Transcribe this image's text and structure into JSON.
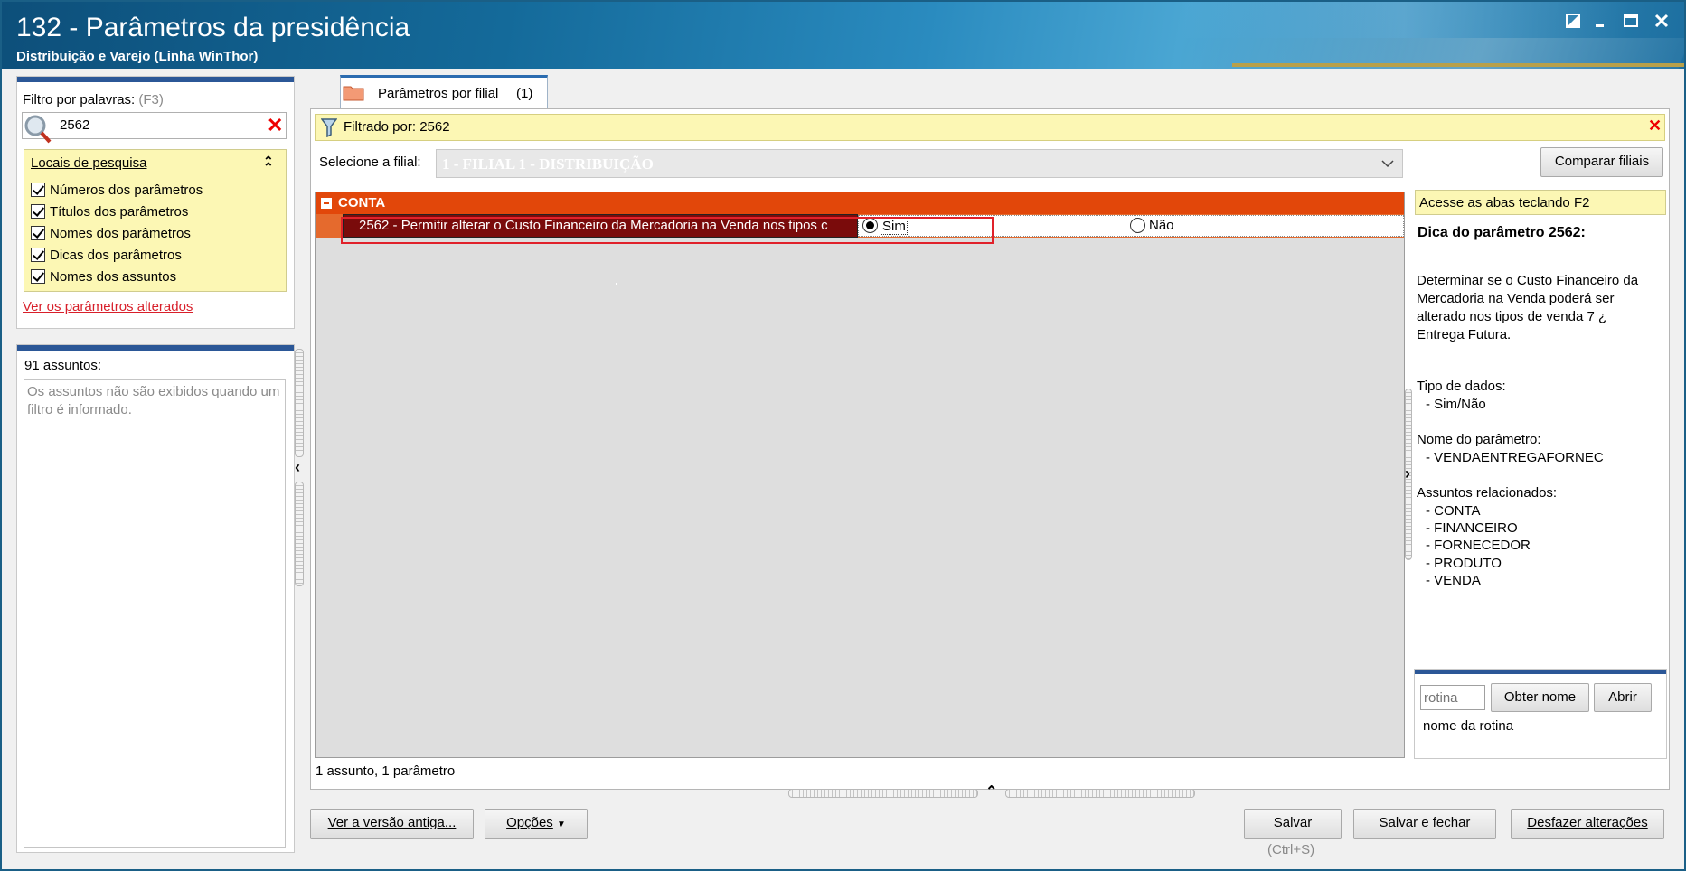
{
  "window": {
    "title": "132 - Parâmetros da presidência",
    "subtitle": "Distribuição e Varejo (Linha WinThor)",
    "controls": [
      "restore-icon",
      "minimize-icon",
      "maximize-icon",
      "close-icon"
    ]
  },
  "filter": {
    "label": "Filtro por palavras:",
    "shortcut": "(F3)",
    "value": "2562",
    "search_locations_title": "Locais de pesquisa",
    "options": [
      {
        "label": "Números dos parâmetros",
        "checked": true
      },
      {
        "label": "Títulos dos parâmetros",
        "checked": true
      },
      {
        "label": "Nomes dos parâmetros",
        "checked": true
      },
      {
        "label": "Dicas dos parâmetros",
        "checked": true
      },
      {
        "label": "Nomes dos assuntos",
        "checked": true
      }
    ],
    "altered_link": "Ver os parâmetros alterados"
  },
  "subjects": {
    "count_label": "91 assuntos:",
    "empty_message": "Os assuntos não são exibidos quando um filtro é informado."
  },
  "tab": {
    "label": "Parâmetros por filial",
    "count": "(1)"
  },
  "filtered": {
    "label": "Filtrado por: 2562"
  },
  "branch": {
    "label": "Selecione a filial:",
    "value": "1 - FILIAL 1 - DISTRIBUIÇÃO",
    "compare_button": "Comparar filiais"
  },
  "grid": {
    "group": "CONTA",
    "param_text": "2562 - Permitir alterar o Custo Financeiro da Mercadoria na Venda nos tipos c",
    "option_yes": "Sim",
    "option_no": "Não",
    "selected": "Sim",
    "status": "1 assunto, 1 parâmetro"
  },
  "help": {
    "hint": "Acesse as abas teclando F2",
    "title": "Dica do parâmetro 2562:",
    "description": "Determinar se o Custo Financeiro da Mercadoria na Venda poderá ser alterado nos tipos de venda 7 ¿ Entrega Futura.",
    "data_type_label": "Tipo de dados:",
    "data_type_value": "- Sim/Não",
    "param_name_label": "Nome do parâmetro:",
    "param_name_value": "- VENDAENTREGAFORNEC",
    "related_label": "Assuntos relacionados:",
    "related": [
      "- CONTA",
      "- FINANCEIRO",
      "- FORNECEDOR",
      "- PRODUTO",
      "- VENDA"
    ]
  },
  "rotina": {
    "placeholder": "rotina",
    "get_name_button": "Obter nome",
    "open_button": "Abrir",
    "name_label": "nome da rotina"
  },
  "footer": {
    "old_version_button": "Ver a versão antiga...",
    "options_button": "Opções",
    "save_button": "Salvar",
    "save_shortcut": "(Ctrl+S)",
    "save_close_button": "Salvar e fechar",
    "undo_button": "Desfazer alterações"
  },
  "colors": {
    "group_row": "#e2470a",
    "selected_param": "#7a0b0b",
    "hint_yellow": "#fcf7b4",
    "link_red": "#d81f2a"
  }
}
